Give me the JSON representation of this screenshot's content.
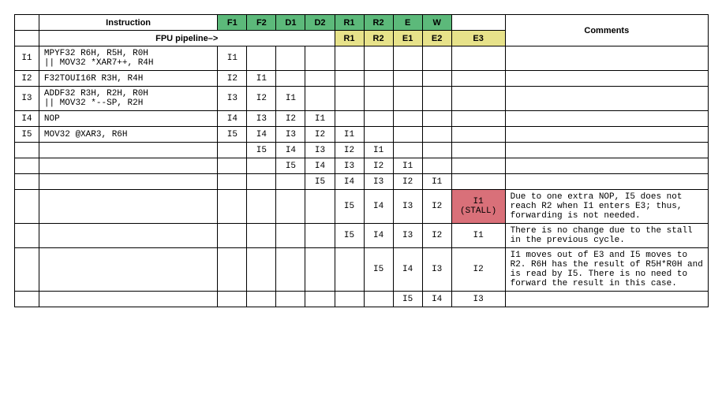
{
  "headers": {
    "instruction": "Instruction",
    "fpu_pipeline": "FPU pipeline–>",
    "comments": "Comments",
    "row1_stages": [
      "F1",
      "F2",
      "D1",
      "D2",
      "R1",
      "R2",
      "E",
      "W"
    ],
    "row2_stages": [
      "R1",
      "R2",
      "E1",
      "E2"
    ],
    "e3": "E3"
  },
  "instructions": {
    "I1": [
      "MPYF32 R6H, R5H, R0H",
      "|| MOV32 *XAR7++, R4H"
    ],
    "I2": [
      "F32TOUI16R R3H, R4H"
    ],
    "I3": [
      "ADDF32 R3H, R2H, R0H",
      "|| MOV32 *--SP, R2H"
    ],
    "I4": [
      "NOP"
    ],
    "I5": [
      "MOV32 @XAR3, R6H"
    ]
  },
  "cycles": [
    {
      "id": "I1",
      "instrKey": "I1",
      "stages": [
        "I1",
        "",
        "",
        "",
        "",
        "",
        "",
        "",
        ""
      ],
      "comment": ""
    },
    {
      "id": "I2",
      "instrKey": "I2",
      "stages": [
        "I2",
        "I1",
        "",
        "",
        "",
        "",
        "",
        "",
        ""
      ],
      "comment": ""
    },
    {
      "id": "I3",
      "instrKey": "I3",
      "stages": [
        "I3",
        "I2",
        "I1",
        "",
        "",
        "",
        "",
        "",
        ""
      ],
      "comment": ""
    },
    {
      "id": "I4",
      "instrKey": "I4",
      "stages": [
        "I4",
        "I3",
        "I2",
        "I1",
        "",
        "",
        "",
        "",
        ""
      ],
      "comment": ""
    },
    {
      "id": "I5",
      "instrKey": "I5",
      "stages": [
        "I5",
        "I4",
        "I3",
        "I2",
        "I1",
        "",
        "",
        "",
        ""
      ],
      "comment": ""
    },
    {
      "id": "",
      "instrKey": "",
      "stages": [
        "",
        "I5",
        "I4",
        "I3",
        "I2",
        "I1",
        "",
        "",
        ""
      ],
      "comment": ""
    },
    {
      "id": "",
      "instrKey": "",
      "stages": [
        "",
        "",
        "I5",
        "I4",
        "I3",
        "I2",
        "I1",
        "",
        ""
      ],
      "comment": ""
    },
    {
      "id": "",
      "instrKey": "",
      "stages": [
        "",
        "",
        "",
        "I5",
        "I4",
        "I3",
        "I2",
        "I1",
        ""
      ],
      "comment": ""
    },
    {
      "id": "",
      "instrKey": "",
      "stages": [
        "",
        "",
        "",
        "",
        "I5",
        "I4",
        "I3",
        "I2",
        "I1 (STALL)"
      ],
      "comment": "Due to one extra NOP, I5 does not reach R2 when I1 enters E3; thus, forwarding is not needed.",
      "e3class": "stall"
    },
    {
      "id": "",
      "instrKey": "",
      "stages": [
        "",
        "",
        "",
        "",
        "I5",
        "I4",
        "I3",
        "I2",
        "I1"
      ],
      "comment": "There is no change due to the stall in the previous cycle."
    },
    {
      "id": "",
      "instrKey": "",
      "stages": [
        "",
        "",
        "",
        "",
        "",
        "I5",
        "I4",
        "I3",
        "I2"
      ],
      "comment": "I1 moves out of E3 and I5 moves to R2. R6H has the result of R5H*R0H and is read by I5. There is no need to forward the result in this case."
    },
    {
      "id": "",
      "instrKey": "",
      "stages": [
        "",
        "",
        "",
        "",
        "",
        "",
        "I5",
        "I4",
        "I3"
      ],
      "comment": ""
    }
  ]
}
